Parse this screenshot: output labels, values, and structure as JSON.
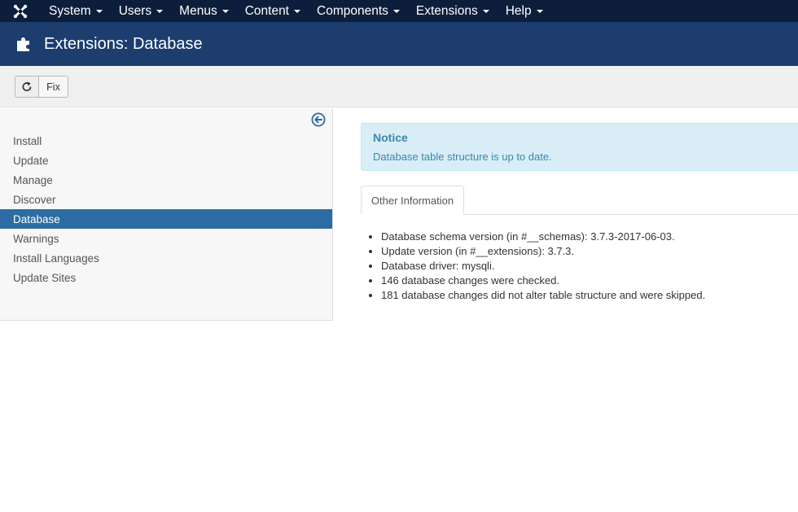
{
  "topnav": {
    "brand_icon": "joomla-logo-icon",
    "items": [
      {
        "label": "System"
      },
      {
        "label": "Users"
      },
      {
        "label": "Menus"
      },
      {
        "label": "Content"
      },
      {
        "label": "Components"
      },
      {
        "label": "Extensions"
      },
      {
        "label": "Help"
      }
    ]
  },
  "header": {
    "icon": "puzzle-piece-icon",
    "title": "Extensions: Database"
  },
  "toolbar": {
    "fix_icon": "refresh-icon",
    "fix_label": "Fix"
  },
  "sidebar": {
    "collapse_icon": "arrow-left-circle-icon",
    "items": [
      {
        "label": "Install"
      },
      {
        "label": "Update"
      },
      {
        "label": "Manage"
      },
      {
        "label": "Discover"
      },
      {
        "label": "Database"
      },
      {
        "label": "Warnings"
      },
      {
        "label": "Install Languages"
      },
      {
        "label": "Update Sites"
      }
    ],
    "active_item": "Database"
  },
  "notice": {
    "title": "Notice",
    "message": "Database table structure is up to date."
  },
  "tabs": [
    {
      "label": "Other Information"
    }
  ],
  "info": [
    "Database schema version (in #__schemas): 3.7.3-2017-06-03.",
    "Update version (in #__extensions): 3.7.3.",
    "Database driver: mysqli.",
    "146 database changes were checked.",
    "181 database changes did not alter table structure and were skipped."
  ],
  "colors": {
    "topnav_bg": "#0d1e3c",
    "header_bg": "#1c3d6e",
    "active_bg": "#2d6ca2",
    "notice_bg": "#d9edf7",
    "notice_text": "#3a87ad"
  }
}
